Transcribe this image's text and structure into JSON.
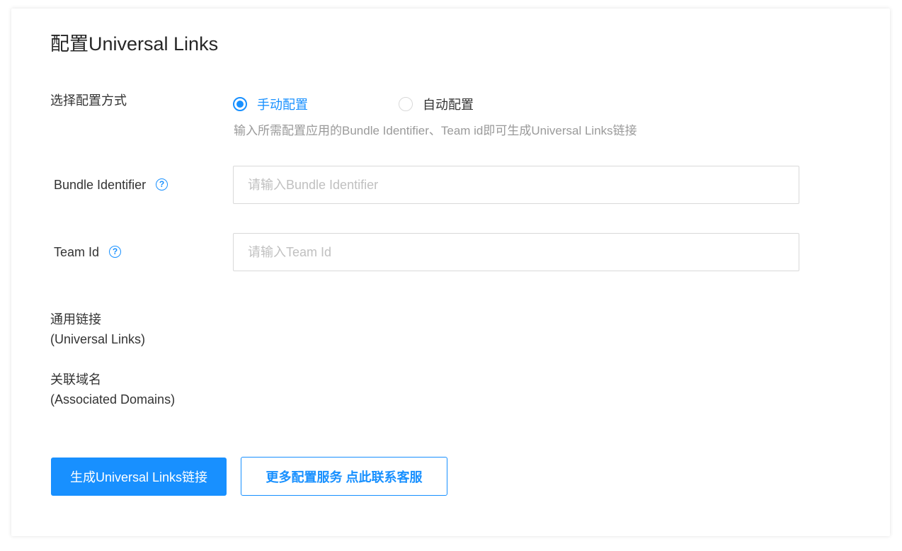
{
  "page": {
    "title": "配置Universal Links"
  },
  "config_mode": {
    "label": "选择配置方式",
    "options": [
      {
        "label": "手动配置",
        "selected": true
      },
      {
        "label": "自动配置",
        "selected": false
      }
    ],
    "hint": "输入所需配置应用的Bundle Identifier、Team id即可生成Universal Links链接"
  },
  "bundle_identifier": {
    "label": "Bundle Identifier",
    "help_icon": "?",
    "placeholder": "请输入Bundle Identifier",
    "value": ""
  },
  "team_id": {
    "label": "Team Id",
    "help_icon": "?",
    "placeholder": "请输入Team Id",
    "value": ""
  },
  "universal_links": {
    "label_line1": "通用链接",
    "label_line2": "(Universal Links)"
  },
  "associated_domains": {
    "label_line1": "关联域名",
    "label_line2": "(Associated Domains)"
  },
  "actions": {
    "generate_label": "生成Universal Links链接",
    "contact_label": "更多配置服务 点此联系客服"
  },
  "colors": {
    "accent": "#1890ff",
    "border": "#d9d9d9",
    "hint_text": "#9a9a9a",
    "placeholder": "#c0c0c0"
  }
}
